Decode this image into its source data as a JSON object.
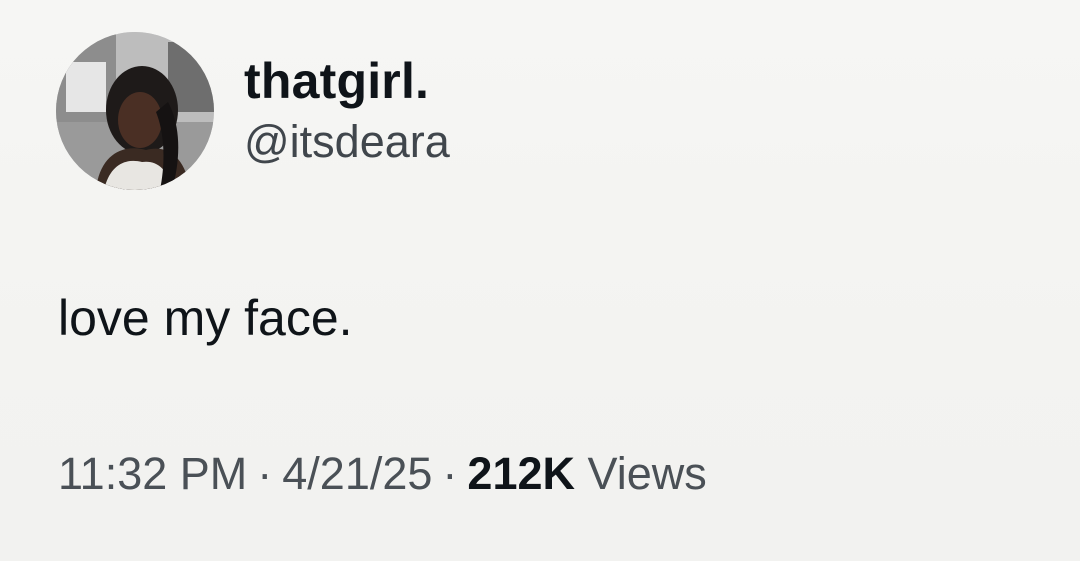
{
  "author": {
    "display_name": "thatgirl.",
    "handle": "@itsdeara",
    "avatar_icon": "profile-photo"
  },
  "tweet": {
    "text": "love my face.",
    "time": "11:32 PM",
    "date": "4/21/25",
    "views_count": "212K",
    "views_label": "Views",
    "separator": "·"
  },
  "colors": {
    "background": "#f4f4f2",
    "text_primary": "#0f1419",
    "text_secondary": "#4a5056"
  }
}
